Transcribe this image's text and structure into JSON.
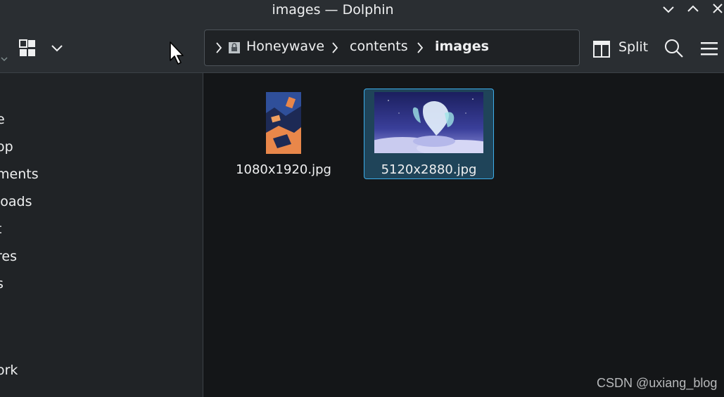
{
  "window": {
    "title": "images — Dolphin"
  },
  "toolbar": {
    "split_label": "Split"
  },
  "breadcrumb": [
    {
      "label": "Honeywave"
    },
    {
      "label": "contents"
    },
    {
      "label": "images"
    }
  ],
  "sidebar": {
    "places": [
      "e",
      "op",
      "ments",
      "loads",
      "t",
      "res",
      "s",
      "ork"
    ]
  },
  "files": [
    {
      "name": "1080x1920.jpg",
      "selected": false
    },
    {
      "name": "5120x2880.jpg",
      "selected": true
    }
  ],
  "watermark": "CSDN @uxiang_blog",
  "colors": {
    "accent": "#3daee9",
    "selection_bg": "#1f4459"
  }
}
